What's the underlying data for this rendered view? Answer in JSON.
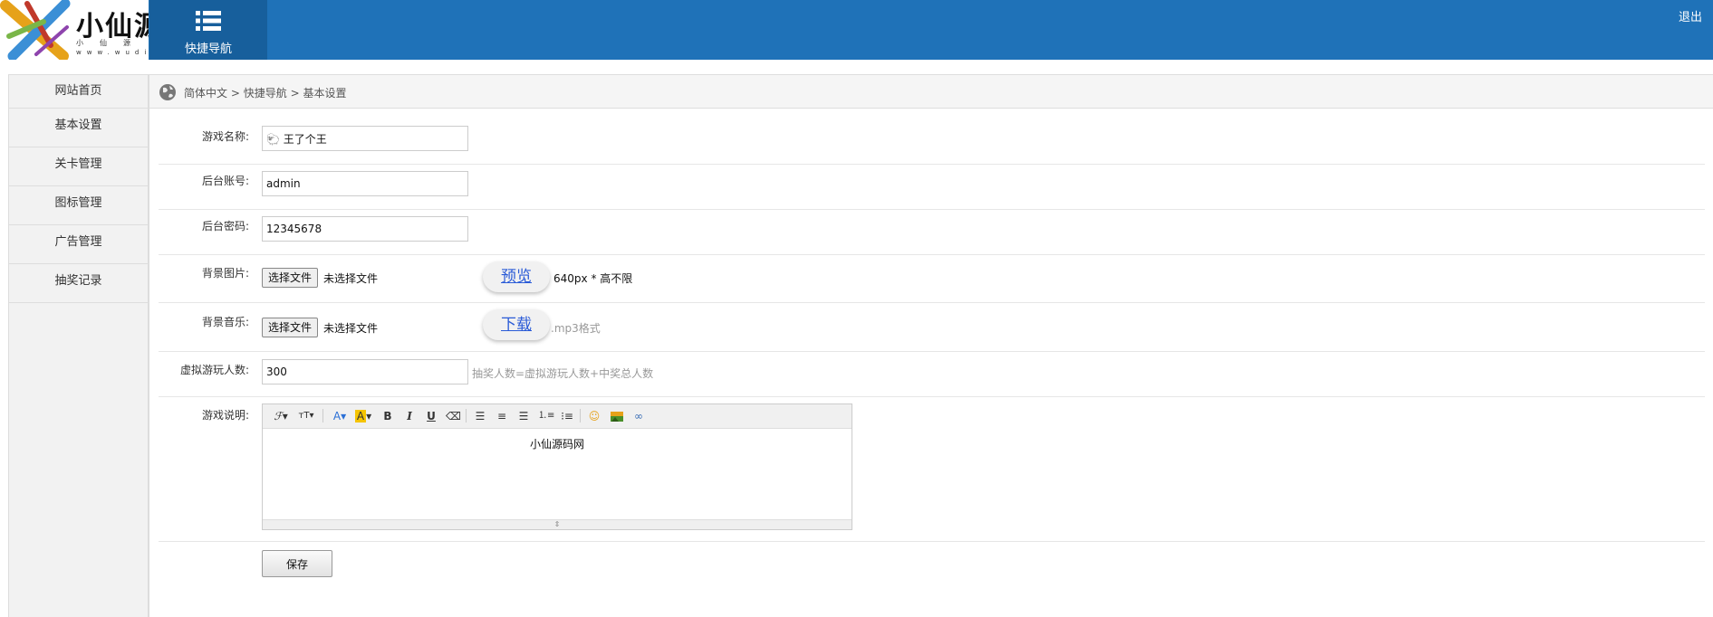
{
  "header": {
    "logo_text": "小仙源",
    "logo_sub": "小仙源",
    "logo_url": "www.wudi",
    "quicknav_label": "快捷导航",
    "logout_label": "退出",
    "colors": {
      "bar": "#1f72b8",
      "quicknav": "#175f9c"
    }
  },
  "sidebar": {
    "items": [
      {
        "label": "网站首页"
      },
      {
        "label": "基本设置"
      },
      {
        "label": "关卡管理"
      },
      {
        "label": "图标管理"
      },
      {
        "label": "广告管理"
      },
      {
        "label": "抽奖记录"
      }
    ]
  },
  "breadcrumb": {
    "items": [
      "简体中文",
      "快捷导航",
      "基本设置"
    ],
    "separator": ">"
  },
  "form": {
    "game_name": {
      "label": "游戏名称:",
      "value": "🐑 王了个王"
    },
    "admin_account": {
      "label": "后台账号:",
      "value": "admin"
    },
    "admin_password": {
      "label": "后台密码:",
      "value": "12345678"
    },
    "background_image": {
      "label": "背景图片:",
      "button": "选择文件",
      "status": "未选择文件",
      "action": "预览",
      "hint": "640px * 高不限"
    },
    "background_music": {
      "label": "背景音乐:",
      "button": "选择文件",
      "status": "未选择文件",
      "action": "下载",
      "hint": ".mp3格式"
    },
    "virtual_players": {
      "label": "虚拟游玩人数:",
      "value": "300",
      "hint": "抽奖人数=虚拟游玩人数+中奖总人数"
    },
    "game_description": {
      "label": "游戏说明:",
      "content": "小仙源码网"
    },
    "save_label": "保存"
  },
  "editor_toolbar": [
    "font-family-icon",
    "font-size-icon",
    "font-color-icon",
    "highlight-color-icon",
    "bold-icon",
    "italic-icon",
    "underline-icon",
    "eraser-icon",
    "align-left-icon",
    "align-center-icon",
    "align-right-icon",
    "ordered-list-icon",
    "unordered-list-icon",
    "emoji-icon",
    "image-icon",
    "link-icon"
  ]
}
